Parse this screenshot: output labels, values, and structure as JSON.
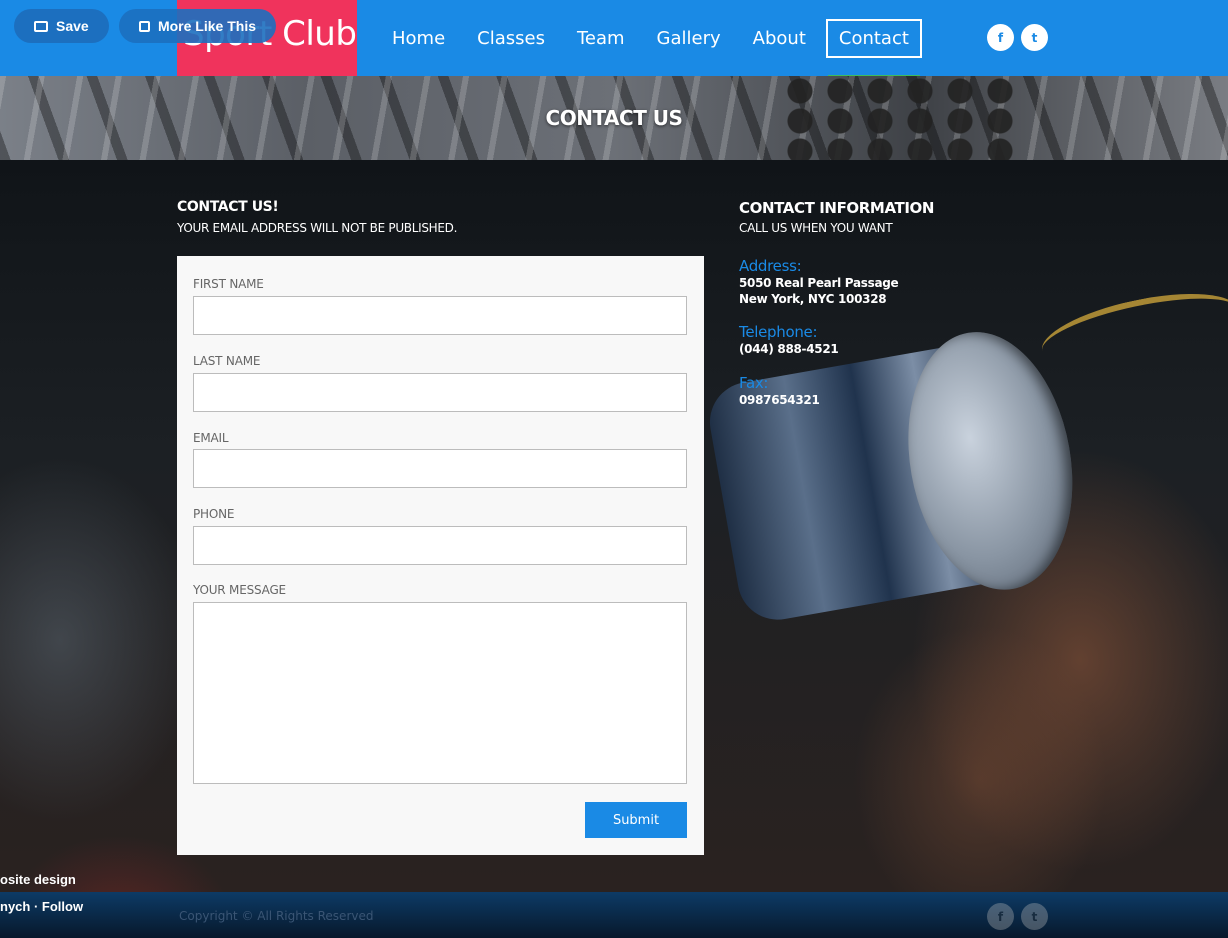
{
  "header": {
    "logo": "Sport Club",
    "nav": [
      "Home",
      "Classes",
      "Team",
      "Gallery",
      "About",
      "Contact"
    ],
    "active_nav": "Contact",
    "social": [
      "f",
      "t"
    ],
    "colors": {
      "bar": "#1a8ae5",
      "logo_bg": "#f0335c"
    }
  },
  "overlay": {
    "save_label": "Save",
    "more_label": "More Like This",
    "bottom_line1": "osite design",
    "bottom_line2": "nych  ·  Follow"
  },
  "banner": {
    "title": "CONTACT US"
  },
  "form": {
    "heading": "CONTACT US!",
    "subheading": "YOUR EMAIL ADDRESS WILL NOT BE PUBLISHED.",
    "first_name_label": "FIRST NAME",
    "last_name_label": "LAST NAME",
    "email_label": "EMAIL",
    "phone_label": "PHONE",
    "message_label": "YOUR MESSAGE",
    "submit_label": "Submit"
  },
  "info": {
    "heading": "CONTACT INFORMATION",
    "subheading": "CALL US WHEN YOU WANT",
    "address_label": "Address:",
    "address_line1": "5050 Real Pearl Passage",
    "address_line2": "New York, NYC 100328",
    "telephone_label": "Telephone:",
    "telephone": "(044) 888-4521",
    "fax_label": "Fax:",
    "fax": "0987654321"
  },
  "footer": {
    "copyright": "Copyright © All Rights Reserved",
    "social": [
      "f",
      "t"
    ]
  }
}
